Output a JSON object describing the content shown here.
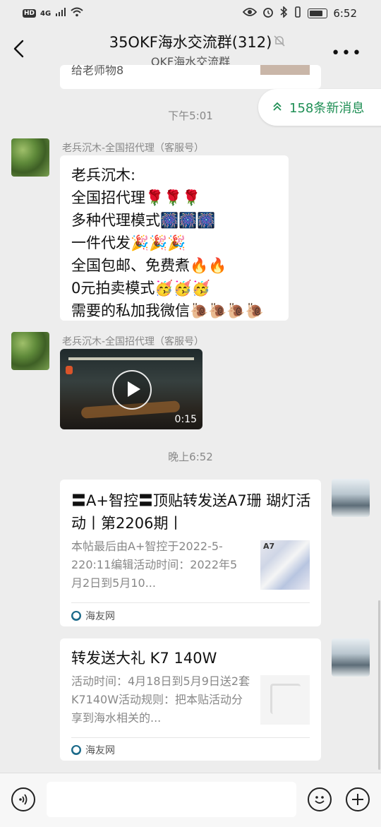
{
  "status_bar": {
    "left_badges": [
      "HD",
      "4G"
    ],
    "time": "6:52"
  },
  "header": {
    "title": "35OKF海水交流群(312)",
    "subtitle": "OKF海水交流群"
  },
  "new_messages_pill": {
    "label": "158条新消息"
  },
  "top_partial_bubble": {
    "text": "给老师物8"
  },
  "messages": [
    {
      "kind": "time",
      "text": "下午5:01"
    },
    {
      "kind": "text",
      "sender": "老兵沉木-全国招代理（客服号）",
      "lines": [
        "老兵沉木:",
        "全国招代理🌹🌹🌹",
        "多种代理模式🎆🎆🎆",
        "一件代发🎉🎉🎉",
        "全国包邮、免费煮🔥🔥",
        "0元拍卖模式🥳🥳🥳",
        "需要的私加我微信🐌🐌🐌🐌"
      ]
    },
    {
      "kind": "video",
      "sender": "老兵沉木-全国招代理（客服号）",
      "duration": "0:15"
    },
    {
      "kind": "time",
      "text": "晚上6:52"
    },
    {
      "kind": "link",
      "title": "〓A+智控〓顶贴转发送A7珊 瑚灯活动丨第2206期丨",
      "description": "本帖最后由A+智控于2022-5-220:11编辑活动时间：2022年5月2日到5月10...",
      "source": "海友网",
      "thumb_label": "A7"
    },
    {
      "kind": "link",
      "title": "转发送大礼 K7 140W",
      "description": "活动时间：4月18日到5月9日送2套K7140W活动规则：把本贴活动分享到海水相关的...",
      "source": "海友网"
    }
  ],
  "colors": {
    "background": "#ededed",
    "bubble": "#ffffff",
    "new_message_green": "#1f8f55"
  }
}
